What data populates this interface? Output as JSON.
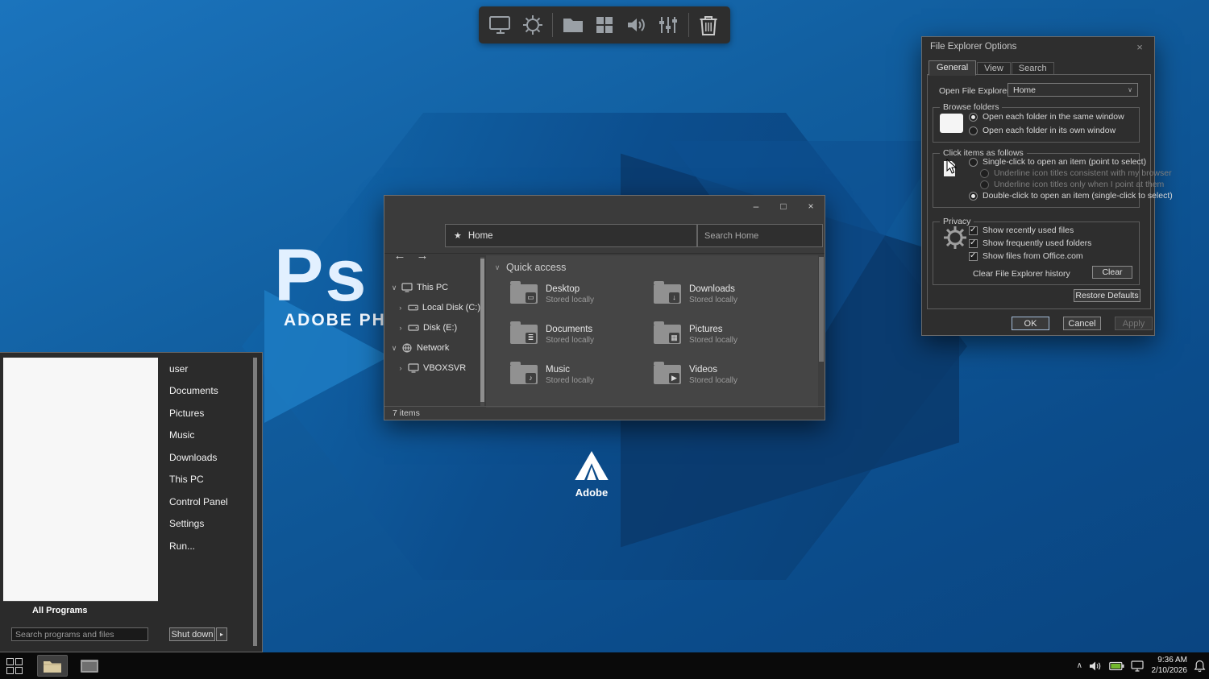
{
  "icons": {
    "minimize": "–",
    "maximize": "□",
    "close": "×",
    "back": "←",
    "forward": "→",
    "star": "★",
    "chevron_expanded": "∨",
    "chevron_collapsed": "›",
    "dropdown_arrow": "∨",
    "tray_chevron": "∧",
    "shutdown_arrow": "▸"
  },
  "wallpaper": {
    "ps_logo": "Ps",
    "brand_text": "ADOBE PHO",
    "adobe_wordmark": "Adobe"
  },
  "dock": {
    "icon_names": [
      "display",
      "settings-gear",
      "file-explorer-folder",
      "windows-grid",
      "volume",
      "audio-mixer",
      "recycle-bin"
    ]
  },
  "explorer": {
    "address": "Home",
    "search_placeholder": "Search Home",
    "section_title": "Quick access",
    "sidebar": [
      {
        "label": "This PC",
        "expanded": true
      },
      {
        "label": "Local Disk (C:)",
        "expanded": false
      },
      {
        "label": "Disk (E:)",
        "expanded": false
      },
      {
        "label": "Network",
        "expanded": true
      },
      {
        "label": "VBOXSVR",
        "expanded": false
      }
    ],
    "items": [
      {
        "name": "Desktop",
        "subtitle": "Stored locally",
        "icon_glyph": "▭"
      },
      {
        "name": "Downloads",
        "subtitle": "Stored locally",
        "icon_glyph": "↓"
      },
      {
        "name": "Documents",
        "subtitle": "Stored locally",
        "icon_glyph": "≣"
      },
      {
        "name": "Pictures",
        "subtitle": "Stored locally",
        "icon_glyph": "▦"
      },
      {
        "name": "Music",
        "subtitle": "Stored locally",
        "icon_glyph": "♪"
      },
      {
        "name": "Videos",
        "subtitle": "Stored locally",
        "icon_glyph": "▶"
      }
    ],
    "status": "7 items"
  },
  "dialog": {
    "title": "File Explorer Options",
    "tabs": [
      "General",
      "View",
      "Search"
    ],
    "open_to_label": "Open File Explorer to:",
    "open_to_value": "Home",
    "browse_folders": {
      "title": "Browse folders",
      "options": [
        {
          "label": "Open each folder in the same window",
          "selected": true
        },
        {
          "label": "Open each folder in its own window",
          "selected": false
        }
      ]
    },
    "click_items": {
      "title": "Click items as follows",
      "options": [
        {
          "label": "Single-click to open an item (point to select)",
          "selected": false,
          "disabled": false
        },
        {
          "label": "Underline icon titles consistent with my browser",
          "selected": false,
          "disabled": true
        },
        {
          "label": "Underline icon titles only when I point at them",
          "selected": false,
          "disabled": true
        },
        {
          "label": "Double-click to open an item (single-click to select)",
          "selected": true,
          "disabled": false
        }
      ]
    },
    "privacy": {
      "title": "Privacy",
      "checkboxes": [
        {
          "label": "Show recently used files",
          "checked": true
        },
        {
          "label": "Show frequently used folders",
          "checked": true
        },
        {
          "label": "Show files from Office.com",
          "checked": true
        }
      ],
      "clear_label": "Clear File Explorer history",
      "clear_button": "Clear"
    },
    "restore_defaults": "Restore Defaults",
    "ok": "OK",
    "cancel": "Cancel",
    "apply": "Apply"
  },
  "start_menu": {
    "items": [
      "user",
      "Documents",
      "Pictures",
      "Music",
      "Downloads",
      "This PC",
      "Control Panel",
      "Settings",
      "Run..."
    ],
    "all_programs": "All Programs",
    "search_placeholder": "Search programs and files",
    "shutdown_label": "Shut down"
  },
  "taskbar": {
    "time": "9:36 AM",
    "date": "2/10/2026"
  },
  "colors": {
    "desktop_blue": "#0f5a9c",
    "window_bg": "#3b3b3b",
    "dialog_bg": "#2e2e2e",
    "battery_green": "#73b82e"
  }
}
